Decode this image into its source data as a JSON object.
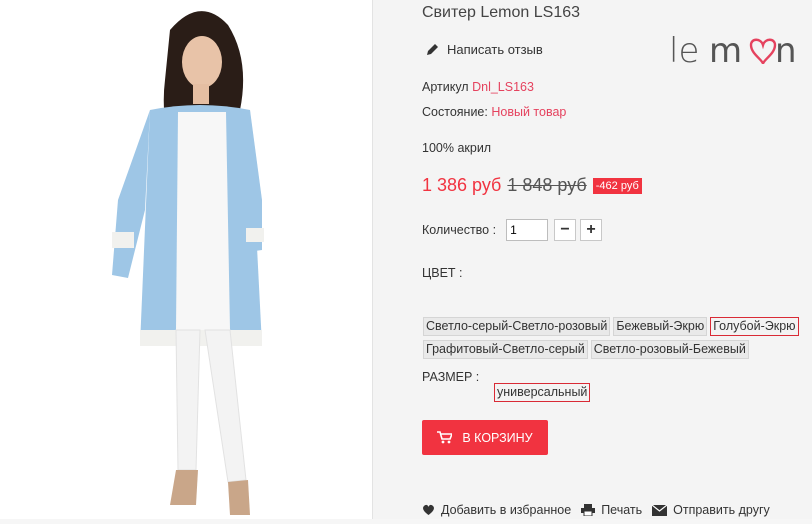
{
  "product": {
    "title": "Свитер Lemon LS163",
    "review_label": "Написать отзыв",
    "sku_label": "Артикул",
    "sku": "Dnl_LS163",
    "condition_label": "Состояние:",
    "condition": "Новый товар",
    "composition": "100% акрил",
    "price_new": "1 386 руб",
    "price_old": "1 848 руб",
    "discount": "-462 руб",
    "qty_label": "Количество :",
    "qty_value": "1",
    "color_label": "ЦВЕТ :",
    "colors": [
      "Светло-серый-Светло-розовый",
      "Бежевый-Экрю",
      "Голубой-Экрю",
      "Графитовый-Светло-серый",
      "Светло-розовый-Бежевый"
    ],
    "selected_color": "Голубой-Экрю",
    "size_label": "РАЗМЕР :",
    "size": "универсальный",
    "cart_label": "В КОРЗИНУ"
  },
  "brand": {
    "logo_text": "lemon"
  },
  "actions": {
    "favorite": "Добавить в избранное",
    "print": "Печать",
    "send": "Отправить другу"
  },
  "colors": {
    "accent": "#f13340",
    "link": "#e5425e",
    "cardigan": "#9ec6e6"
  }
}
